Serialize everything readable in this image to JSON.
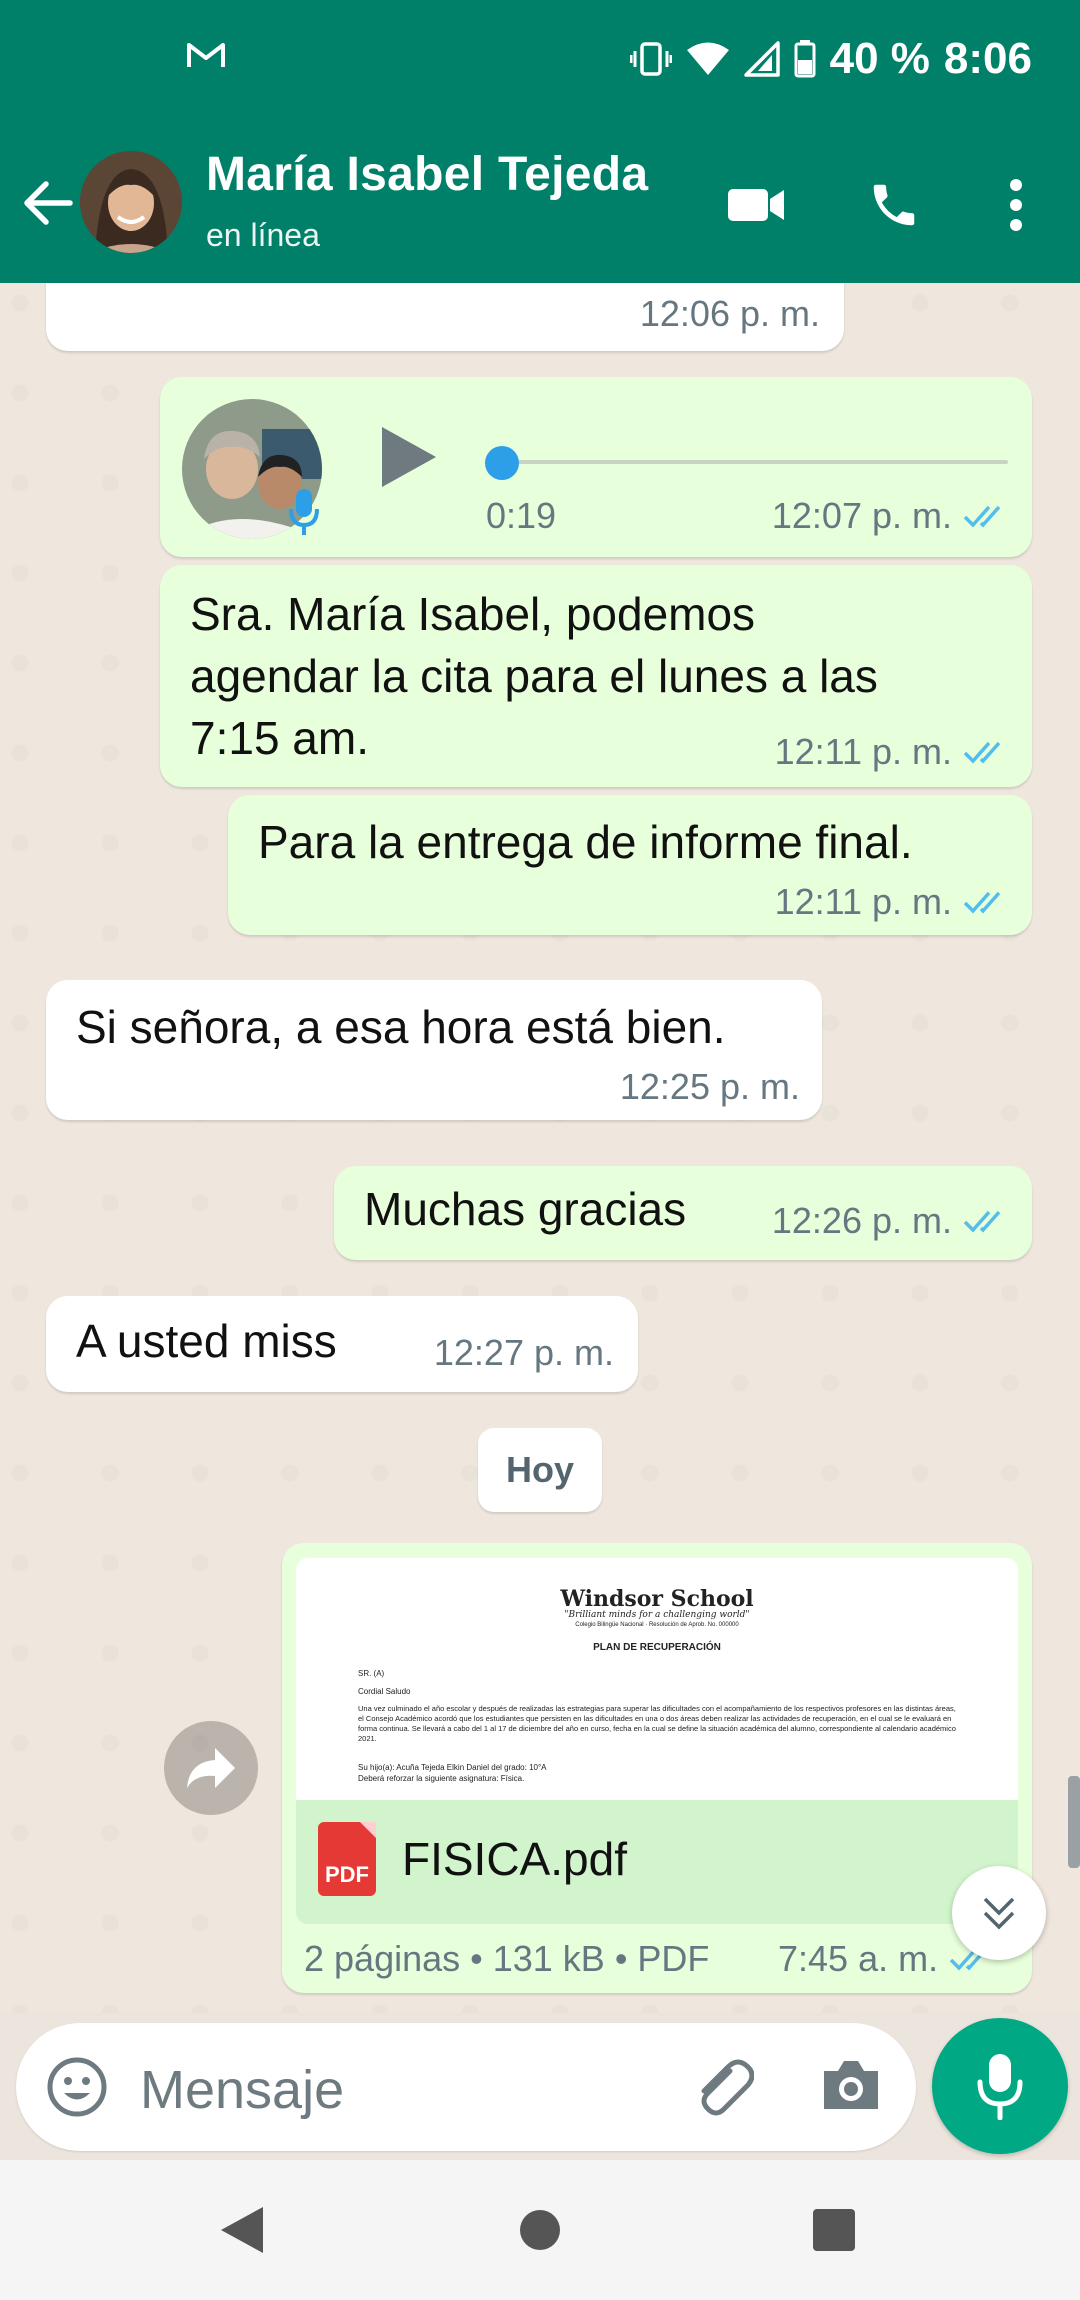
{
  "status_bar": {
    "battery": "40 %",
    "time": "8:06"
  },
  "header": {
    "contact_name": "María Isabel Tejeda",
    "contact_status": "en línea"
  },
  "messages": [
    {
      "id": "m0",
      "direction": "in",
      "text": "",
      "time": "12:06 p. m."
    },
    {
      "id": "m1",
      "direction": "out",
      "type": "voice",
      "duration": "0:19",
      "time": "12:07 p. m.",
      "progress": 0
    },
    {
      "id": "m2",
      "direction": "out",
      "text_lines": [
        "Sra. María Isabel, podemos",
        "agendar  la cita para el lunes a las",
        "7:15 am."
      ],
      "time": "12:11 p. m."
    },
    {
      "id": "m3",
      "direction": "out",
      "text": "Para la entrega de informe final.",
      "time": "12:11 p. m."
    },
    {
      "id": "m4",
      "direction": "in",
      "text": "Si señora, a esa hora está bien.",
      "time": "12:25 p. m."
    },
    {
      "id": "m5",
      "direction": "out",
      "text": "Muchas gracias",
      "time": "12:26 p. m."
    },
    {
      "id": "m6",
      "direction": "in",
      "text": "A usted miss",
      "time": "12:27 p. m."
    }
  ],
  "date_chip": "Hoy",
  "document": {
    "preview": {
      "school": "Windsor School",
      "motto": "\"Brilliant minds for a challenging world\"",
      "sub": "Colegio Bilingüe Nacional  ·  Resolución de Aprob. No. 000000",
      "heading": "PLAN DE RECUPERACIÓN",
      "line_sr": "SR. (A)",
      "line_greeting": "Cordial Saludo",
      "body": "Una vez culminado el año escolar y después de realizadas las estrategias para superar las dificultades con el acompañamiento de los respectivos profesores en las distintas áreas, el Consejo Académico acordó que los estudiantes que persisten en las dificultades en una o dos áreas deben realizar las actividades de recuperación, en el cual se le evaluará en forma continua. Se llevará a cabo del 1 al 17 de diciembre del año en curso, fecha en la cual se define la situación académica del alumno, correspondiente al calendario académico 2021.",
      "student_line": "Su hijo(a): Acuña Tejeda Elkin Daniel            del grado: 10°A",
      "subject_line": "Deberá reforzar la siguiente asignatura: Física."
    },
    "file_badge": "PDF",
    "file_name": "FISICA.pdf",
    "info": "2 páginas • 131 kB • PDF",
    "time": "7:45 a. m."
  },
  "input": {
    "placeholder": "Mensaje"
  },
  "colors": {
    "header": "#008069",
    "outgoing_bubble": "#e7ffdb",
    "incoming_bubble": "#ffffff",
    "read_ticks": "#53bdeb",
    "mic_button": "#00a884",
    "pdf_red": "#e53935"
  },
  "icons": {
    "status_left": "gmail-icon",
    "status_right": [
      "vibrate-icon",
      "wifi-icon",
      "signal-icon",
      "battery-icon"
    ],
    "header": [
      "back-arrow-icon",
      "video-call-icon",
      "phone-icon",
      "more-vert-icon"
    ],
    "input": [
      "emoji-icon",
      "attach-icon",
      "camera-icon",
      "mic-icon"
    ],
    "nav": [
      "nav-back-icon",
      "nav-home-icon",
      "nav-recents-icon"
    ]
  }
}
